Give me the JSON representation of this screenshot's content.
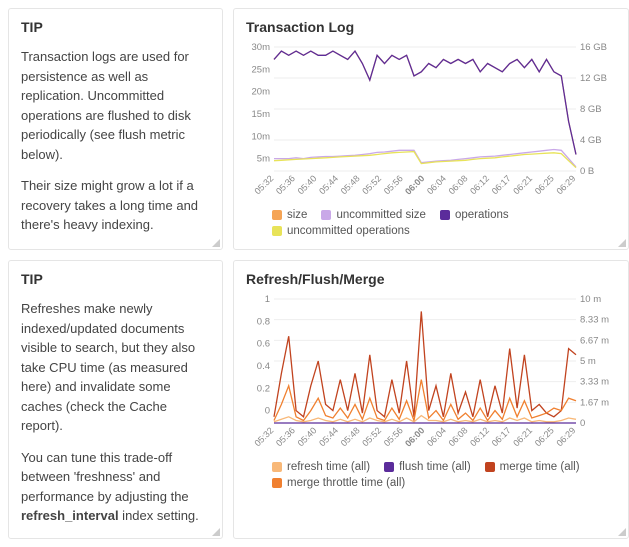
{
  "tips": [
    {
      "title": "TIP",
      "paragraphs": [
        "Transaction logs are used for persistence as well as replication. Uncommitted operations are flushed to disk periodically (see flush metric below).",
        "Their size might grow a lot if a recovery takes a long time and there's heavy indexing."
      ]
    },
    {
      "title": "TIP",
      "paragraphs": [
        "Refreshes make newly indexed/updated documents visible to search, but they also take CPU time (as measured here) and invalidate some caches (check the Cache report).",
        "You can tune this trade-off between 'freshness' and performance by adjusting the <strong>refresh_interval</strong> index setting."
      ]
    }
  ],
  "charts": [
    {
      "title": "Transaction Log"
    },
    {
      "title": "Refresh/Flush/Merge"
    }
  ],
  "chart_data": [
    {
      "type": "line",
      "title": "Transaction Log",
      "x_ticks": [
        "05:32",
        "05:36",
        "05:40",
        "05:44",
        "05:48",
        "05:52",
        "05:56",
        "06:00",
        "06:04",
        "06:08",
        "06:12",
        "06:17",
        "06:21",
        "06:25",
        "06:29"
      ],
      "y_left": {
        "ticks": [
          "30m",
          "25m",
          "20m",
          "15m",
          "10m",
          "5m"
        ],
        "label": ""
      },
      "y_right": {
        "ticks": [
          "16 GB",
          "12 GB",
          "8 GB",
          "4 GB",
          "0 B"
        ],
        "label": ""
      },
      "legend": [
        {
          "name": "size",
          "color": "#f5a455"
        },
        {
          "name": "uncommitted size",
          "color": "#c9a8e8"
        },
        {
          "name": "operations",
          "color": "#5b2c9b"
        },
        {
          "name": "uncommitted operations",
          "color": "#e8e359"
        }
      ],
      "series": [
        {
          "name": "size",
          "color": "#f5a455",
          "values": [
            27,
            29,
            28,
            29,
            28,
            29,
            28,
            28,
            29,
            28,
            27,
            29,
            26,
            22,
            28,
            26,
            28,
            27,
            28,
            23,
            24,
            26,
            25,
            27,
            26,
            27,
            26,
            27,
            24,
            26,
            25,
            24,
            26,
            27,
            25,
            27,
            24,
            27,
            24,
            23,
            12,
            4
          ]
        },
        {
          "name": "operations",
          "color": "#5b2c9b",
          "values": [
            27,
            29,
            28,
            29,
            28,
            29,
            28,
            28,
            29,
            28,
            27,
            29,
            26,
            22,
            28,
            26,
            28,
            27,
            28,
            23,
            24,
            26,
            25,
            27,
            26,
            27,
            26,
            27,
            24,
            26,
            25,
            24,
            26,
            27,
            25,
            27,
            24,
            27,
            24,
            23,
            12,
            4
          ]
        },
        {
          "name": "uncommitted size",
          "color": "#c9a8e8",
          "values": [
            3,
            3,
            3,
            3.2,
            3,
            3.3,
            3.4,
            3.5,
            3.5,
            3.6,
            3.7,
            3.8,
            4,
            4.2,
            4.5,
            4.6,
            4.8,
            5,
            5,
            5,
            2,
            2.2,
            2.4,
            2.5,
            2.6,
            2.8,
            3,
            3.2,
            3.4,
            3.5,
            3.6,
            3.8,
            4,
            4.2,
            4.4,
            4.6,
            4.8,
            5,
            5.2,
            5,
            3,
            1
          ]
        },
        {
          "name": "uncommitted operations",
          "color": "#e8e359",
          "values": [
            2.5,
            2.6,
            2.7,
            2.8,
            2.9,
            3,
            3.1,
            3.2,
            3.3,
            3.4,
            3.5,
            3.6,
            3.7,
            3.8,
            4,
            4.2,
            4.4,
            4.5,
            4.6,
            4.7,
            1.8,
            2,
            2.2,
            2.3,
            2.4,
            2.5,
            2.6,
            2.8,
            3,
            3.1,
            3.2,
            3.4,
            3.6,
            3.8,
            4,
            4.1,
            4.2,
            4.3,
            4.4,
            4.2,
            2.5,
            0.8
          ]
        }
      ],
      "y_domain": [
        0,
        30
      ]
    },
    {
      "type": "line",
      "title": "Refresh/Flush/Merge",
      "x_ticks": [
        "05:32",
        "05:36",
        "05:40",
        "05:44",
        "05:48",
        "05:52",
        "05:56",
        "06:00",
        "06:04",
        "06:08",
        "06:12",
        "06:17",
        "06:21",
        "06:25",
        "06:29"
      ],
      "y_left": {
        "ticks": [
          "1",
          "0.8",
          "0.6",
          "0.4",
          "0.2",
          "0"
        ],
        "label": ""
      },
      "y_right": {
        "ticks": [
          "10 m",
          "8.33 m",
          "6.67 m",
          "5 m",
          "3.33 m",
          "1.67 m",
          "0"
        ],
        "label": ""
      },
      "legend": [
        {
          "name": "refresh time (all)",
          "color": "#f8b878"
        },
        {
          "name": "flush time (all)",
          "color": "#5b2c9b"
        },
        {
          "name": "merge time (all)",
          "color": "#c1431f"
        },
        {
          "name": "merge throttle time (all)",
          "color": "#f08030"
        }
      ],
      "series": [
        {
          "name": "merge time (all)",
          "color": "#c1431f",
          "values": [
            0.05,
            0.4,
            0.7,
            0.1,
            0.05,
            0.3,
            0.5,
            0.15,
            0.1,
            0.35,
            0.1,
            0.4,
            0.08,
            0.55,
            0.1,
            0.05,
            0.35,
            0.08,
            0.5,
            0.05,
            0.9,
            0.1,
            0.3,
            0.05,
            0.4,
            0.08,
            0.25,
            0.05,
            0.35,
            0.05,
            0.3,
            0.08,
            0.6,
            0.12,
            0.55,
            0.1,
            0.15,
            0.08,
            0.05,
            0.1,
            0.6,
            0.55
          ]
        },
        {
          "name": "merge throttle time (all)",
          "color": "#f08030",
          "values": [
            0.02,
            0.15,
            0.3,
            0.05,
            0.02,
            0.1,
            0.2,
            0.06,
            0.04,
            0.12,
            0.04,
            0.15,
            0.03,
            0.2,
            0.04,
            0.02,
            0.12,
            0.03,
            0.18,
            0.02,
            0.35,
            0.04,
            0.1,
            0.02,
            0.15,
            0.03,
            0.08,
            0.02,
            0.12,
            0.02,
            0.1,
            0.03,
            0.2,
            0.05,
            0.18,
            0.04,
            0.06,
            0.08,
            0.12,
            0.1,
            0.2,
            0.18
          ]
        },
        {
          "name": "refresh time (all)",
          "color": "#f8b878",
          "values": [
            0.01,
            0.03,
            0.05,
            0.02,
            0.01,
            0.02,
            0.04,
            0.02,
            0.01,
            0.03,
            0.01,
            0.03,
            0.01,
            0.04,
            0.02,
            0.01,
            0.03,
            0.01,
            0.04,
            0.01,
            0.06,
            0.02,
            0.02,
            0.01,
            0.03,
            0.01,
            0.02,
            0.01,
            0.03,
            0.01,
            0.02,
            0.01,
            0.04,
            0.02,
            0.04,
            0.01,
            0.02,
            0.01,
            0.01,
            0.02,
            0.04,
            0.03
          ]
        },
        {
          "name": "flush time (all)",
          "color": "#5b2c9b",
          "values": [
            0,
            0,
            0,
            0,
            0,
            0,
            0,
            0,
            0,
            0,
            0,
            0,
            0,
            0,
            0,
            0,
            0,
            0,
            0,
            0,
            0,
            0,
            0,
            0,
            0,
            0,
            0,
            0,
            0,
            0,
            0,
            0,
            0,
            0,
            0,
            0,
            0,
            0,
            0,
            0,
            0,
            0
          ]
        }
      ],
      "y_domain": [
        0,
        1
      ]
    }
  ]
}
